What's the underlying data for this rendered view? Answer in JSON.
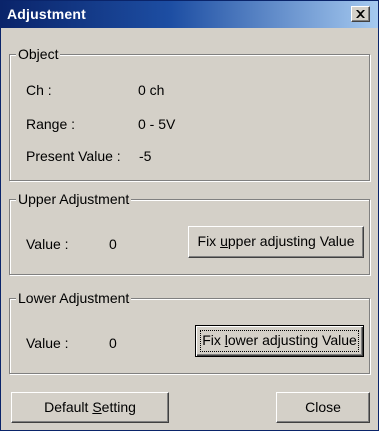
{
  "window": {
    "title": "Adjustment",
    "close_glyph": "×"
  },
  "object": {
    "legend": "Object",
    "ch_label": "Ch :",
    "ch_value": "0 ch",
    "range_label": "Range :",
    "range_value": "0 - 5V",
    "present_label": "Present Value :",
    "present_value": "-5"
  },
  "upper": {
    "legend": "Upper Adjustment",
    "value_label": "Value :",
    "value": "0",
    "button_pre": "Fix ",
    "button_mnemonic": "u",
    "button_post": "pper adjusting Value"
  },
  "lower": {
    "legend": "Lower Adjustment",
    "value_label": "Value :",
    "value": "0",
    "button_pre": "Fix ",
    "button_mnemonic": "l",
    "button_post": "ower adjusting Value"
  },
  "footer": {
    "default_pre": "Default ",
    "default_mnemonic": "S",
    "default_post": "etting",
    "close_label": "Close"
  },
  "icons": {
    "close": "close-icon"
  },
  "colors": {
    "title_start": "#0a246a",
    "title_end": "#a6caf0",
    "face": "#d4d0c8"
  }
}
